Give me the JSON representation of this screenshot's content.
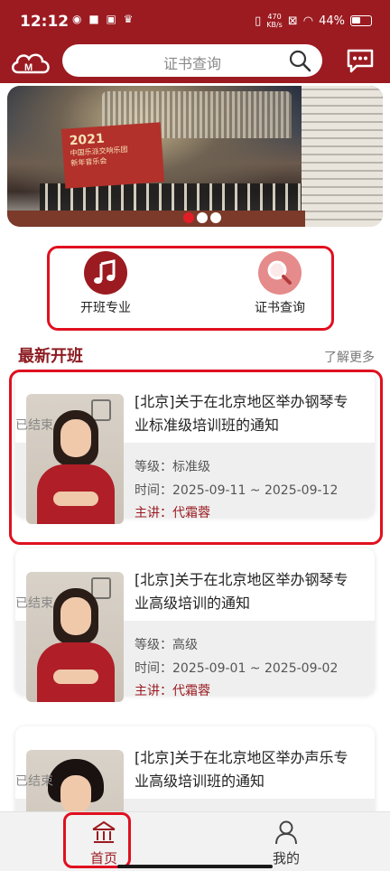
{
  "status_bar": {
    "time": "12:12",
    "speed_value": "470",
    "speed_unit": "KB/s",
    "battery": "44%"
  },
  "header": {
    "search_placeholder": "证书查询",
    "logo_icon": "cloud-logo-icon",
    "chat_icon": "chat-icon",
    "brand_color": "#9b1b21"
  },
  "banner": {
    "year": "2021",
    "line1": "中国乐派交响乐团",
    "line2": "新年音乐会",
    "slide_count": 3,
    "active_slide": 1
  },
  "quick_actions": [
    {
      "label": "开班专业",
      "icon": "music-note-icon"
    },
    {
      "label": "证书查询",
      "icon": "search-icon"
    }
  ],
  "section": {
    "title": "最新开班",
    "more": "了解更多"
  },
  "courses": [
    {
      "title": "[北京]关于在北京地区举办钢琴专业标准级培训班的通知",
      "status": "已结束",
      "level": "等级：标准级",
      "time": "时间：2025-09-11 ~ 2025-09-12",
      "lecturer": "主讲：代霜蓉"
    },
    {
      "title": "[北京]关于在北京地区举办钢琴专业高级培训的通知",
      "status": "已结束",
      "level": "等级：高级",
      "time": "时间：2025-09-01 ~ 2025-09-02",
      "lecturer": "主讲：代霜蓉"
    },
    {
      "title": "[北京]关于在北京地区举办声乐专业高级培训班的通知",
      "status": "已结束"
    }
  ],
  "bottom_nav": [
    {
      "label": "首页",
      "icon": "home-icon",
      "active": true
    },
    {
      "label": "我的",
      "icon": "user-icon",
      "active": false
    }
  ]
}
